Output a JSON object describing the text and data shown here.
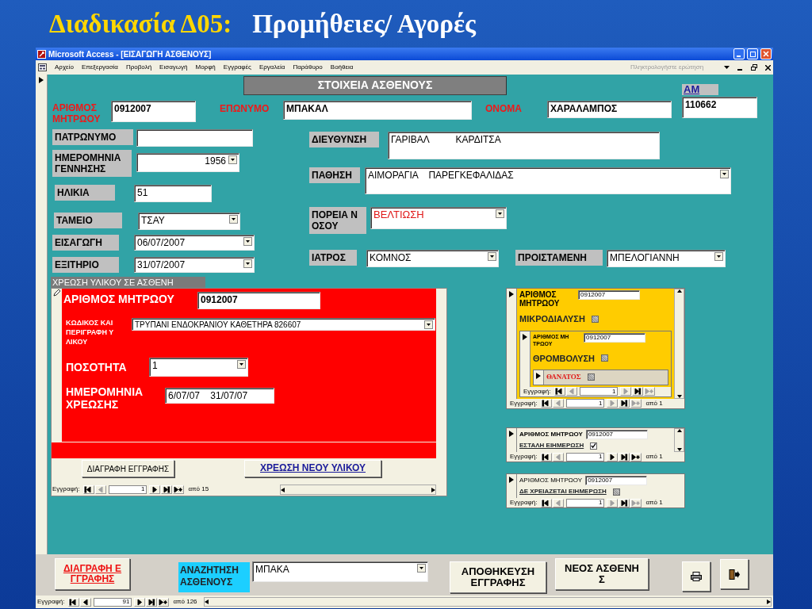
{
  "slide_title": {
    "code": "Διαδικασία Δ05:",
    "text": "Προμήθειες/ Αγορές"
  },
  "window": {
    "title": "Microsoft Access - [ΕΙΣΑΓΩΓΗ ΑΣΘΕΝΟΥΣ]"
  },
  "menu": {
    "items": [
      "Αρχείο",
      "Επεξεργασία",
      "Προβολή",
      "Εισαγωγή",
      "Μορφή",
      "Εγγραφές",
      "Εργαλεία",
      "Παράθυρο",
      "Βοήθεια"
    ],
    "help_placeholder": "Πληκτρολογήστε ερώτηση"
  },
  "form": {
    "header": "ΣΤΟΙΧΕΙΑ ΑΣΘΕΝΟΥΣ",
    "fields": [
      {
        "label": "ΑΡΙΘΜΟΣ ΜΗΤΡΩΟΥ",
        "required": true,
        "label_link": false,
        "kind": "text",
        "value": "0912007",
        "emphasis": false
      },
      {
        "label": "ΕΠΩΝΥΜΟ",
        "required": true,
        "label_link": false,
        "kind": "text",
        "value": "ΜΠΑΚΑΛ",
        "emphasis": false
      },
      {
        "label": "ΟΝΟΜΑ",
        "required": true,
        "label_link": false,
        "kind": "text",
        "value": "ΧΑΡΑΛΑΜΠΟΣ",
        "emphasis": false
      },
      {
        "label": "ΑΜ",
        "required": false,
        "label_link": true,
        "kind": "text",
        "value": "110662",
        "emphasis": false
      },
      {
        "label": "ΠΑΤΡΩΝΥΜΟ",
        "required": false,
        "label_link": false,
        "kind": "text"
      },
      {
        "label": "ΗΜΕΡΟΜΗΝΙΑ ΓΕΝΝΗΣΗΣ",
        "required": false,
        "label_link": false,
        "kind": "combo_right",
        "value": "1956",
        "emphasis": false
      },
      {
        "label": "ΗΛΙΚΙΑ",
        "required": false,
        "label_link": false,
        "kind": "text",
        "value": "51",
        "emphasis": false
      },
      {
        "label": "ΤΑΜΕΙΟ",
        "required": false,
        "label_link": false,
        "kind": "combo",
        "value": "ΤΣΑΥ",
        "emphasis": false
      },
      {
        "label": "ΕΙΣΑΓΩΓΗ",
        "required": false,
        "label_link": false,
        "kind": "combo",
        "value": "06/07/2007",
        "emphasis": false
      },
      {
        "label": "ΕΞΙΤΗΡΙΟ",
        "required": false,
        "label_link": false,
        "kind": "combo",
        "value": "31/07/2007",
        "emphasis": false
      },
      {
        "label": "ΔΙΕΥΘΥΝΣΗ",
        "required": false,
        "label_link": false,
        "kind": "text",
        "value": "ΓΑΡΙΒΑΛ          ΚΑΡΔΙΤΣΑ",
        "emphasis": false
      },
      {
        "label": "ΠΑΘΗΣΗ",
        "required": false,
        "label_link": false,
        "kind": "combo",
        "value": "ΑΙΜΟΡΑΓΙΑ    ΠΑΡΕΓΚΕΦΑΛΙΔΑΣ",
        "emphasis": false
      },
      {
        "label": "ΠΟΡΕΙΑ Ν ΟΣΟΥ",
        "required": false,
        "label_link": false,
        "kind": "combo",
        "value": "ΒΕΛΤΙΩΣΗ",
        "emphasis": true
      },
      {
        "label": "ΙΑΤΡΟΣ",
        "required": false,
        "label_link": false,
        "kind": "combo",
        "value": "ΚΟΜΝΟΣ",
        "emphasis": false
      },
      {
        "label": "ΠΡΟΙΣΤΑΜΕΝΗ",
        "required": false,
        "label_link": false,
        "kind": "combo",
        "value": "ΜΠΕΛΟΓΙΑΝΝΗ",
        "emphasis": false
      }
    ],
    "charge_subform": {
      "caption": "ΧΡΕΩΣΗ ΥΛΙΚΟΥ ΣΕ ΑΣΘΕΝΗ",
      "fields": [
        {
          "label": "ΑΡΙΘΜΟΣ ΜΗΤΡΩΟΥ",
          "kind": "text",
          "value": "0912007"
        },
        {
          "label": "ΚΩΔΙΚΟΣ ΚΑΙ ΠΕΡΙΓΡΑΦΗ Υ ΛΙΚΟΥ",
          "kind": "combo",
          "value": "ΤΡΥΠΑΝΙ ΕΝΔΟΚΡΑΝΙΟΥ ΚΑΘΕΤΗΡΑ 826607"
        },
        {
          "label": "ΠΟΣΟΤΗΤΑ",
          "kind": "combo",
          "value": "1"
        },
        {
          "label": "ΗΜΕΡΟΜΗΝΙΑ ΧΡΕΩΣΗΣ",
          "kind": "text",
          "value": "6/07/07    31/07/07"
        }
      ],
      "buttons": [
        {
          "label": "ΔΙΑΓΡΑΦΗ ΕΓΓΡΑΦΗΣ",
          "kind": "plain"
        },
        {
          "label": "ΧΡΕΩΣΗ ΝΕΟΥ ΥΛΙΚΟΥ",
          "kind": "link"
        }
      ],
      "nav": {
        "label": "Εγγραφή:",
        "record": "1",
        "total": "από 15",
        "prev_disabled": true,
        "next_disabled": false,
        "new_disabled": false
      }
    },
    "status_subforms": [
      {
        "color": "#ffcc00",
        "field": {
          "label": "ΑΡΙΘΜΟΣ ΜΗΤΡΩΟΥ",
          "value": "0912007"
        },
        "check": {
          "label": "ΜΙΚΡΟΔΙΑΛΥΣΗ",
          "checked": false
        },
        "child": {
          "color": "#ffcc00",
          "field": {
            "label": "ΑΡΙΘΜΟΣ ΜΗ ΤΡΩΟΥ",
            "value": "0912007"
          },
          "check": {
            "label": "ΘΡΟΜΒΟΛΥΣΗ",
            "checked": false
          },
          "child": {
            "color": "#ddd6c2",
            "check": {
              "label": "ΘΑΝΑΤΟΣ",
              "checked": false
            }
          },
          "nav": {
            "label": "Εγγραφή:",
            "record": "1",
            "prev_disabled": true,
            "next_disabled": true,
            "new_disabled": true
          }
        },
        "nav": {
          "label": "Εγγραφή:",
          "record": "1",
          "total": "από 1",
          "prev_disabled": true,
          "next_disabled": true,
          "new_disabled": true
        }
      },
      {
        "color": "#f3f1e2",
        "field": {
          "label": "ΑΡΙΘΜΟΣ ΜΗΤΡΩΟΥ",
          "value": "0912007"
        },
        "check": {
          "label": "ΕΣΤΑΛΗ ΕΙΗΜΕΡΩΣΗ",
          "checked": true
        },
        "nav": {
          "label": "Εγγραφή:",
          "record": "1",
          "total": "από 1",
          "prev_disabled": true,
          "next_disabled": false,
          "new_disabled": false
        }
      },
      {
        "color": "#f3f1e2",
        "field": {
          "label": "ΑΡΙΘΜΟΣ ΜΗΤΡΩΟΥ",
          "value": "0912007"
        },
        "check": {
          "label": "ΔΕ ΧΡΕΙΑΖΕΤΑΙ ΕΙΗΜΕΡΩΣΗ",
          "checked": false
        },
        "nav": {
          "label": "Εγγραφή:",
          "record": "1",
          "total": "από 1",
          "prev_disabled": true,
          "next_disabled": true,
          "new_disabled": true
        }
      }
    ],
    "footer": {
      "buttons": [
        {
          "label": "ΔΙΑΓΡΑΦΗ Ε ΓΓΡΑΦΗΣ",
          "kind": "danger"
        },
        {
          "label": "ΑΠΟΘΗΚΕΥΣΗ ΕΓΓΡΑΦΗΣ",
          "kind": "plain"
        },
        {
          "label": "ΝΕΟΣ ΑΣΘΕΝΗ Σ",
          "kind": "plain"
        }
      ],
      "search": {
        "label": "ΑΝΑΖΗΤΗΣΗ ΑΣΘΕΝΟΥΣ",
        "value": "ΜΠΑΚΑ"
      }
    },
    "nav": {
      "label": "Εγγραφή:",
      "record": "91",
      "total": "από 126",
      "prev_disabled": false,
      "next_disabled": false,
      "new_disabled": false
    }
  }
}
